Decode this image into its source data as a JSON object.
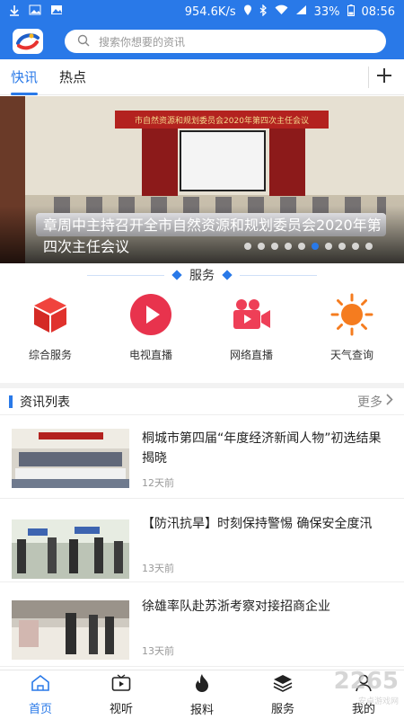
{
  "status_bar": {
    "speed": "954.6K/s",
    "battery": "33%",
    "time": "08:56"
  },
  "search": {
    "placeholder": "搜索你想要的资讯"
  },
  "tabs": [
    {
      "label": "快讯",
      "active": true
    },
    {
      "label": "热点",
      "active": false
    }
  ],
  "banner": {
    "stage_banner_text": "市自然资源和规划委员会2020年第四次主任会议",
    "caption": "章周中主持召开全市自然资源和规划委员会2020年第四次主任会议",
    "slide_count": 10,
    "active_slide": 5
  },
  "services": {
    "title": "服务",
    "items": [
      {
        "label": "综合服务",
        "icon": "cube-icon",
        "color": "#e0322d"
      },
      {
        "label": "电视直播",
        "icon": "play-icon",
        "color": "#e8334d"
      },
      {
        "label": "网络直播",
        "icon": "video-camera-icon",
        "color": "#ee3f57"
      },
      {
        "label": "天气查询",
        "icon": "sun-icon",
        "color": "#f57c1f"
      }
    ]
  },
  "news_list": {
    "title": "资讯列表",
    "more": "更多",
    "items": [
      {
        "title": "桐城市第四届“年度经济新闻人物”初选结果揭晓",
        "time": "12天前"
      },
      {
        "title": "【防汛抗旱】时刻保持警惕 确保安全度汛",
        "time": "13天前"
      },
      {
        "title": "徐雄率队赴苏浙考察对接招商企业",
        "time": "13天前"
      }
    ]
  },
  "tabbar": [
    {
      "label": "首页",
      "icon": "home-icon",
      "active": true
    },
    {
      "label": "视听",
      "icon": "tv-icon",
      "active": false
    },
    {
      "label": "报料",
      "icon": "fire-icon",
      "active": false
    },
    {
      "label": "服务",
      "icon": "layers-icon",
      "active": false
    },
    {
      "label": "我的",
      "icon": "user-icon",
      "active": false
    }
  ],
  "watermark": {
    "text": "2265",
    "sub": "安卓游戏网"
  },
  "colors": {
    "brand": "#2979e8"
  }
}
